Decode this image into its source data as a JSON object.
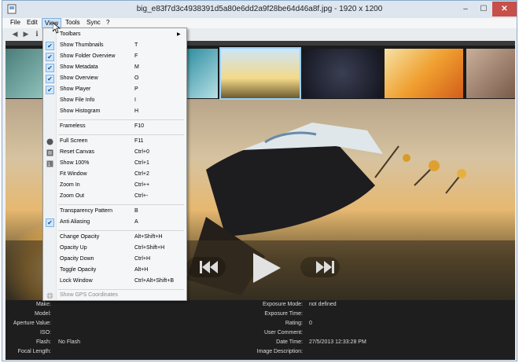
{
  "window": {
    "title": "big_e83f7d3c4938391d5a80e6dd2a9f28be64d46a8f.jpg - 1920 x 1200"
  },
  "window_buttons": {
    "minimize": "–",
    "maximize": "☐",
    "close": "✕"
  },
  "menubar": {
    "file": "File",
    "edit": "Edit",
    "view": "View",
    "tools": "Tools",
    "sync": "Sync",
    "help": "?"
  },
  "toolbar": {
    "back_icon": "arrow-left-icon",
    "forward_icon": "arrow-right-icon",
    "info_icon": "info-icon"
  },
  "view_menu": {
    "toolbars": "Toolbars",
    "show_thumbnails": {
      "label": "Show Thumbnails",
      "shortcut": "T",
      "checked": true
    },
    "show_folder_overview": {
      "label": "Show Folder Overview",
      "shortcut": "F",
      "checked": true
    },
    "show_metadata": {
      "label": "Show Metadata",
      "shortcut": "M",
      "checked": true
    },
    "show_overview": {
      "label": "Show Overview",
      "shortcut": "O",
      "checked": true
    },
    "show_player": {
      "label": "Show Player",
      "shortcut": "P",
      "checked": true
    },
    "show_file_info": {
      "label": "Show File Info",
      "shortcut": "I"
    },
    "show_histogram": {
      "label": "Show Histogram",
      "shortcut": "H"
    },
    "frameless": {
      "label": "Frameless",
      "shortcut": "F10"
    },
    "full_screen": {
      "label": "Full Screen",
      "shortcut": "F11"
    },
    "reset_canvas": {
      "label": "Reset Canvas",
      "shortcut": "Ctrl+0"
    },
    "show_100": {
      "label": "Show 100%",
      "shortcut": "Ctrl+1"
    },
    "fit_window": {
      "label": "Fit Window",
      "shortcut": "Ctrl+2"
    },
    "zoom_in": {
      "label": "Zoom In",
      "shortcut": "Ctrl++"
    },
    "zoom_out": {
      "label": "Zoom Out",
      "shortcut": "Ctrl+-"
    },
    "transparency_pattern": {
      "label": "Transparency Pattern",
      "shortcut": "B"
    },
    "anti_aliasing": {
      "label": "Anti Aliasing",
      "shortcut": "A",
      "checked": true
    },
    "change_opacity": {
      "label": "Change Opacity",
      "shortcut": "Alt+Shift+H"
    },
    "opacity_up": {
      "label": "Opacity Up",
      "shortcut": "Ctrl+Shift+H"
    },
    "opacity_down": {
      "label": "Opacity Down",
      "shortcut": "Ctrl+H"
    },
    "toggle_opacity": {
      "label": "Toggle Opacity",
      "shortcut": "Alt+H"
    },
    "lock_window": {
      "label": "Lock Window",
      "shortcut": "Ctrl+Alt+Shift+B"
    },
    "show_gps": {
      "label": "Show GPS Coordinates",
      "disabled": true
    }
  },
  "metadata": {
    "left": [
      {
        "label": "Make:",
        "value": ""
      },
      {
        "label": "Model:",
        "value": ""
      },
      {
        "label": "Aperture Value:",
        "value": ""
      },
      {
        "label": "ISO:",
        "value": ""
      },
      {
        "label": "Flash:",
        "value": "No Flash"
      },
      {
        "label": "Focal Length:",
        "value": ""
      }
    ],
    "right": [
      {
        "label": "Exposure Mode:",
        "value": "not defined"
      },
      {
        "label": "Exposure Time:",
        "value": ""
      },
      {
        "label": "Rating:",
        "value": "0"
      },
      {
        "label": "User Comment:",
        "value": ""
      },
      {
        "label": "Date Time:",
        "value": "27/5/2013 12:33:28 PM"
      },
      {
        "label": "Image Description:",
        "value": ""
      }
    ]
  }
}
